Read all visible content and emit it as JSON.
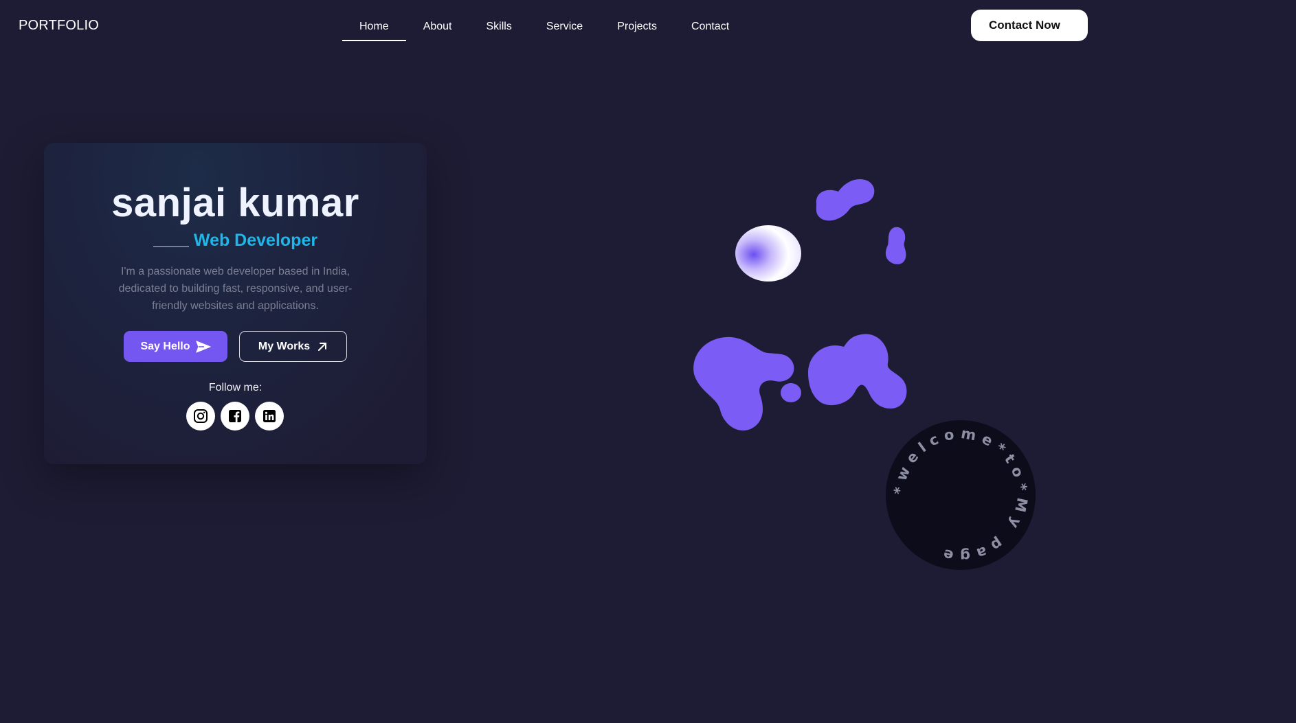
{
  "header": {
    "logo": "PORTFOLIO",
    "nav": [
      "Home",
      "About",
      "Skills",
      "Service",
      "Projects",
      "Contact"
    ],
    "active_nav": "Home",
    "cta": "Contact Now"
  },
  "hero": {
    "name": "sanjai kumar",
    "role": "Web Developer",
    "description": "I'm a passionate web developer based in India, dedicated to building fast, responsive, and user-friendly websites and applications.",
    "primary_button": "Say Hello",
    "secondary_button": "My Works",
    "follow_label": "Follow me:",
    "socials": [
      "instagram-icon",
      "facebook-icon",
      "linkedin-icon"
    ]
  },
  "badge": {
    "text": "*welcome*to*My page"
  },
  "colors": {
    "background": "#1e1c34",
    "accent": "#7457f1",
    "role": "#1fb6ea",
    "blob": "#7b5cf5"
  }
}
